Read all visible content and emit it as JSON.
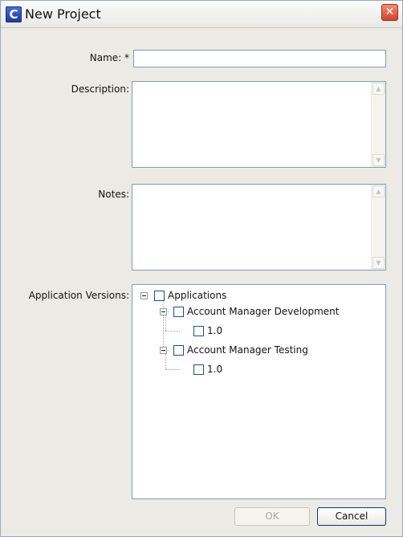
{
  "window": {
    "title": "New Project",
    "icon_letter": "C",
    "close_glyph": "✕"
  },
  "form": {
    "name_label": "Name: *",
    "name_value": "",
    "description_label": "Description:",
    "notes_label": "Notes:",
    "app_versions_label": "Application Versions:"
  },
  "tree": {
    "root": {
      "label": "Applications",
      "expanded": true,
      "checked": false
    },
    "apps": [
      {
        "label": "Account Manager Development",
        "expanded": true,
        "checked": false,
        "versions": [
          {
            "label": "1.0",
            "checked": false
          }
        ]
      },
      {
        "label": "Account Manager Testing",
        "expanded": true,
        "checked": false,
        "versions": [
          {
            "label": "1.0",
            "checked": false
          }
        ]
      }
    ]
  },
  "buttons": {
    "ok_label": "OK",
    "ok_enabled": false,
    "cancel_label": "Cancel"
  },
  "icons": {
    "app_icon": "app-logo-icon",
    "close_icon": "close-icon",
    "scroll_up": "scroll-up-arrow-icon",
    "scroll_down": "scroll-down-arrow-icon",
    "expander": "tree-collapse-icon"
  },
  "colors": {
    "dialog_bg": "#eceae4",
    "field_border": "#7f9db9",
    "close_button": "#d6422a"
  }
}
